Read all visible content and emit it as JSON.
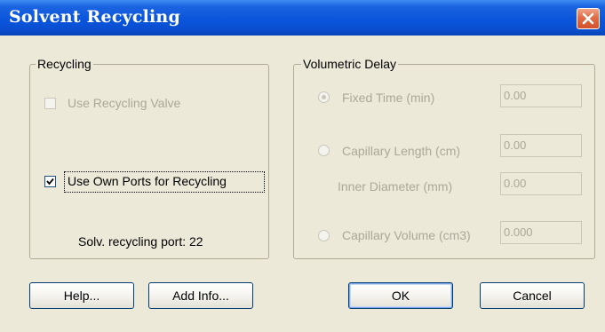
{
  "window": {
    "title": "Solvent Recycling"
  },
  "recycling": {
    "legend": "Recycling",
    "use_recycling_valve": {
      "label": "Use Recycling Valve",
      "checked": false,
      "enabled": false
    },
    "use_own_ports": {
      "label": "Use Own Ports for Recycling",
      "checked": true,
      "enabled": true
    },
    "port_text": "Solv. recycling port: 22"
  },
  "volumetric_delay": {
    "legend": "Volumetric Delay",
    "fixed_time": {
      "label": "Fixed Time (min)",
      "value": "0.00",
      "selected": true,
      "enabled": false
    },
    "capillary_length": {
      "label": "Capillary Length (cm)",
      "value": "0.00",
      "selected": false,
      "enabled": false
    },
    "inner_diameter": {
      "label": "Inner Diameter (mm)",
      "value": "0.00",
      "enabled": false
    },
    "capillary_volume": {
      "label": "Capillary Volume (cm3)",
      "value": "0.000",
      "selected": false,
      "enabled": false
    }
  },
  "buttons": {
    "help": "Help...",
    "add_info": "Add Info...",
    "ok": "OK",
    "cancel": "Cancel"
  },
  "colors": {
    "title_bar": "#0a55dc",
    "face": "#ece9d8",
    "close": "#d2522c",
    "disabled_text": "#aca899"
  },
  "icons": {
    "close": "close-icon",
    "check": "check-icon"
  }
}
